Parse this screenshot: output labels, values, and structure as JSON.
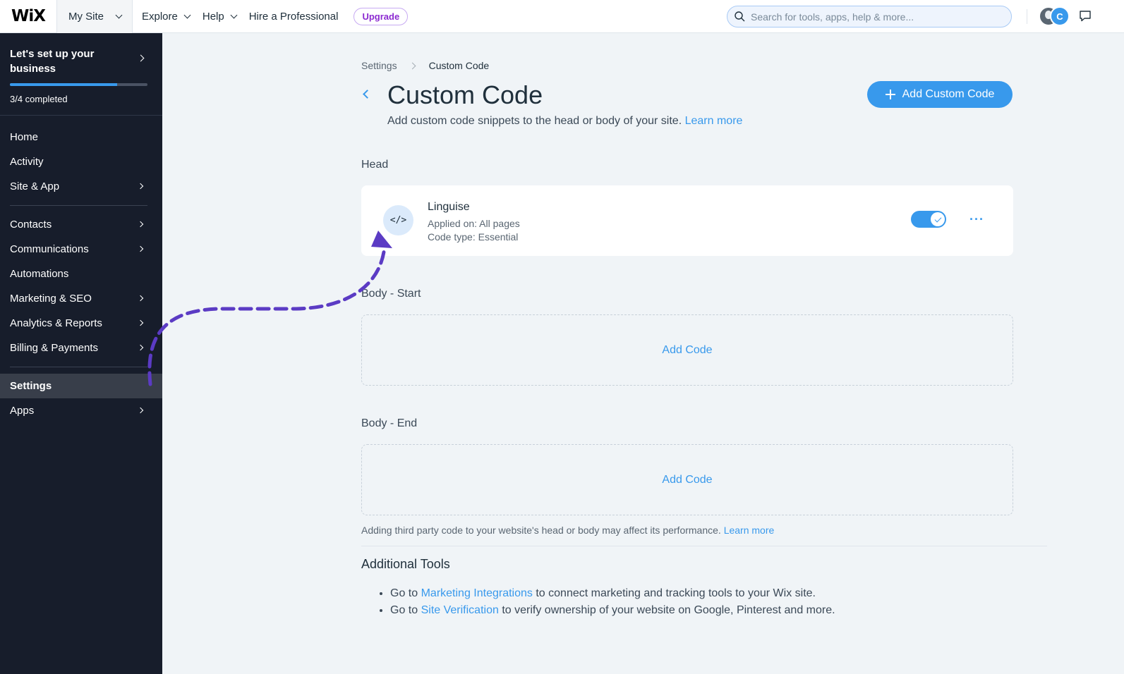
{
  "topbar": {
    "logo": "WiX",
    "site_name": "My Site",
    "nav": [
      "Explore",
      "Help",
      "Hire a Professional"
    ],
    "upgrade": "Upgrade",
    "search_placeholder": "Search for tools, apps, help & more...",
    "avatar_initial": "C"
  },
  "sidebar": {
    "setup_title": "Let's set up your business",
    "setup_progress_fraction": 0.78,
    "setup_status": "3/4 completed",
    "items": [
      {
        "label": "Home"
      },
      {
        "label": "Activity"
      },
      {
        "label": "Site & App"
      },
      {
        "label": "Contacts"
      },
      {
        "label": "Communications"
      },
      {
        "label": "Automations"
      },
      {
        "label": "Marketing & SEO"
      },
      {
        "label": "Analytics & Reports"
      },
      {
        "label": "Billing & Payments"
      },
      {
        "label": "Settings"
      },
      {
        "label": "Apps"
      }
    ],
    "active_item": "Settings"
  },
  "main": {
    "breadcrumb": [
      "Settings",
      "Custom Code"
    ],
    "title": "Custom Code",
    "subtitle": "Add custom code snippets to the head or body of your site.",
    "learn_more": "Learn more",
    "add_button": "Add Custom Code",
    "sections": {
      "head": "Head",
      "body_start": "Body - Start",
      "body_end": "Body - End"
    },
    "snippet": {
      "icon_text": "</>",
      "name": "Linguise",
      "applied": "Applied on: All pages",
      "code_type": "Code type: Essential",
      "enabled": true,
      "more": "···"
    },
    "add_code": "Add Code",
    "notice": "Adding third party code to your website's head or body may affect its performance.",
    "notice_link": "Learn more",
    "additional_tools": {
      "title": "Additional Tools",
      "items": [
        {
          "prefix": "Go to",
          "link": "Marketing Integrations",
          "suffix": "to connect marketing and tracking tools to your Wix site."
        },
        {
          "prefix": "Go to",
          "link": "Site Verification",
          "suffix": "to verify ownership of your website on Google, Pinterest and more."
        }
      ]
    }
  },
  "colors": {
    "accent": "#3899ec",
    "sidebar_bg": "#171d2b",
    "annotation_arrow": "#5b3bc4",
    "upgrade": "#8c2ad1"
  }
}
